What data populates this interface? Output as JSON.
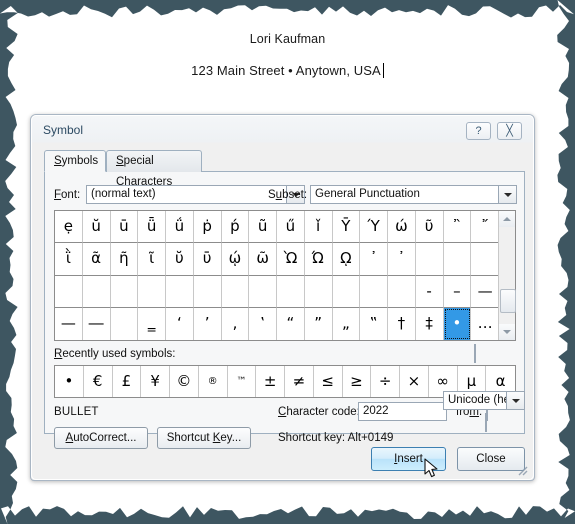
{
  "document": {
    "name_line": "Lori Kaufman",
    "address_line": "123 Main Street • Anytown, USA"
  },
  "dialog": {
    "title": "Symbol",
    "help_button": "?",
    "close_button": "╳",
    "tabs": [
      {
        "label": "Symbols",
        "active": true
      },
      {
        "label": "Special Characters",
        "active": false
      }
    ],
    "font": {
      "label": "Font:",
      "value": "(normal text)"
    },
    "subset": {
      "label": "Subset:",
      "value": "General Punctuation"
    },
    "symbol_grid": {
      "columns": 16,
      "rows": 4,
      "selected_index": 62,
      "cells": [
        "ẹ",
        "ŭ",
        "ū",
        "ǖ",
        "ǘ",
        "ṗ",
        "ṕ",
        "ũ",
        "ű",
        "ǐ",
        "Ȳ",
        "Ύ",
        "ώ",
        "ῦ",
        "῍",
        "῎",
        "ῒ",
        "ᾶ",
        "ῆ",
        "ῖ",
        "ῠ",
        "ῡ",
        "ῴ",
        "ῶ",
        "Ὼ",
        "Ώ",
        "ῼ",
        "᾽",
        "᾿",
        "",
        "",
        "",
        "",
        "",
        "",
        "",
        "",
        "",
        "",
        "",
        "",
        "",
        "",
        "",
        "",
        "‐",
        "–",
        "—",
        "—",
        "―",
        "",
        "‗",
        "‘",
        "’",
        "‚",
        "‛",
        "“",
        "”",
        "„",
        "‟",
        "†",
        "‡",
        "•",
        "…"
      ]
    },
    "recently_used": {
      "label": "Recently used symbols:",
      "symbols": [
        "•",
        "€",
        "£",
        "¥",
        "©",
        "®",
        "™",
        "±",
        "≠",
        "≤",
        "≥",
        "÷",
        "×",
        "∞",
        "μ",
        "α"
      ]
    },
    "symbol_name": "BULLET",
    "character_code": {
      "label": "Character code:",
      "value": "2022"
    },
    "from": {
      "label": "from:",
      "value": "Unicode (hex)"
    },
    "autocorrect_button": "AutoCorrect...",
    "shortcut_key_button": "Shortcut Key...",
    "shortcut_key_text": "Shortcut key: Alt+0149",
    "insert_button": "Insert",
    "close_footer_button": "Close"
  },
  "colors": {
    "selection_blue": "#3399e6",
    "title_text": "#2c4a62",
    "dialog_bg": "#f0f0f0",
    "torn_edge": "#3e5661"
  }
}
